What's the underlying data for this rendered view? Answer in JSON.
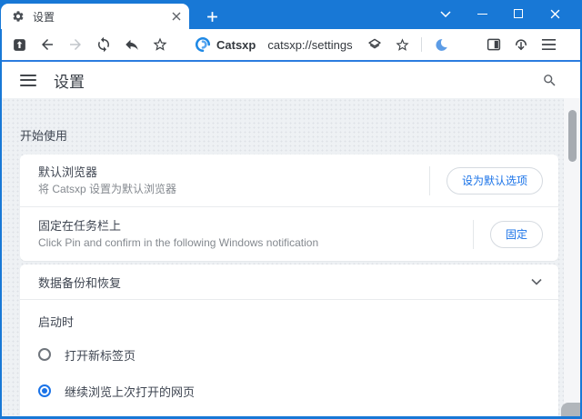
{
  "colors": {
    "titlebar_blue": "#1878d6",
    "accent_blue": "#1a73e8",
    "moon_blue": "#5c9ce6",
    "content_bg": "#eef1f4"
  },
  "titlebar": {
    "tab": {
      "icon": "gear-icon",
      "title": "设置",
      "close_icon": "close-icon"
    },
    "new_tab_icon": "plus-icon",
    "window_controls": [
      "chevron-down-icon",
      "minimize-icon",
      "maximize-icon",
      "close-icon"
    ]
  },
  "toolbar": {
    "left_icons": [
      "boxed-up-arrow-icon",
      "back-icon",
      "forward-icon",
      "refresh-icon",
      "undo-icon",
      "star-icon"
    ],
    "logo_icon": "catsxp-logo",
    "site_label": "Catsxp",
    "url": "catsxp://settings",
    "right_icons": [
      "layers-icon",
      "bookmark-star-icon",
      "moon-icon",
      "sidebar-icon",
      "download-icon",
      "menu-icon"
    ]
  },
  "header": {
    "menu_icon": "hamburger-icon",
    "title": "设置",
    "search_icon": "search-icon"
  },
  "content": {
    "section_label": "开始使用",
    "card1": {
      "rows": [
        {
          "title": "默认浏览器",
          "subtitle": "将 Catsxp 设置为默认浏览器",
          "button_label": "设为默认选项"
        },
        {
          "title": "固定在任务栏上",
          "subtitle": "Click Pin and confirm in the following Windows notification",
          "button_label": "固定"
        }
      ]
    },
    "card2": {
      "backup_row": {
        "title": "数据备份和恢复",
        "chevron_icon": "chevron-down-icon"
      },
      "startup": {
        "label": "启动时",
        "options": [
          {
            "label": "打开新标签页",
            "selected": false
          },
          {
            "label": "继续浏览上次打开的网页",
            "selected": true
          }
        ]
      }
    }
  }
}
